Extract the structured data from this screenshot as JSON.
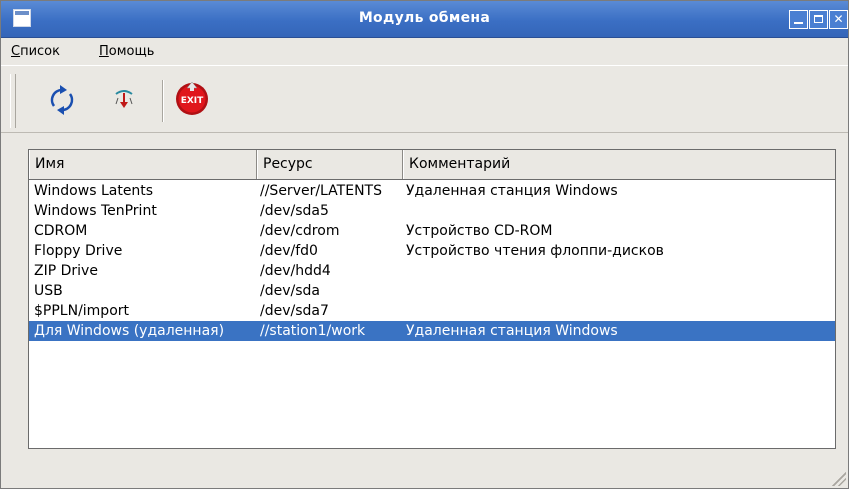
{
  "window": {
    "title": "Модуль обмена"
  },
  "menu": {
    "items": [
      {
        "accel": "С",
        "rest": "писок"
      },
      {
        "accel": "П",
        "rest": "омощь"
      }
    ]
  },
  "toolbar": {
    "buttons": [
      {
        "icon": "refresh-icon"
      },
      {
        "icon": "transfer-icon"
      },
      {
        "icon": "exit-icon",
        "label": "EXIT"
      }
    ]
  },
  "list": {
    "columns": [
      "Имя",
      "Ресурс",
      "Комментарий"
    ],
    "rows": [
      {
        "name": "Windows Latents",
        "resource": "//Server/LATENTS",
        "comment": "Удаленная станция Windows"
      },
      {
        "name": "Windows TenPrint",
        "resource": "/dev/sda5",
        "comment": ""
      },
      {
        "name": "CDROM",
        "resource": "/dev/cdrom",
        "comment": "Устройство CD-ROM"
      },
      {
        "name": "Floppy Drive",
        "resource": "/dev/fd0",
        "comment": "Устройство чтения флоппи-дисков"
      },
      {
        "name": "ZIP Drive",
        "resource": "/dev/hdd4",
        "comment": ""
      },
      {
        "name": "USB",
        "resource": "/dev/sda",
        "comment": ""
      },
      {
        "name": "$PPLN/import",
        "resource": "/dev/sda7",
        "comment": ""
      },
      {
        "name": "Для Windows (удаленная)",
        "resource": "//station1/work",
        "comment": "Удаленная станция Windows",
        "selected": true
      }
    ]
  },
  "colors": {
    "titlebar": "#3b6fc4",
    "selection": "#3a73c3",
    "exit_red": "#d9141a"
  }
}
